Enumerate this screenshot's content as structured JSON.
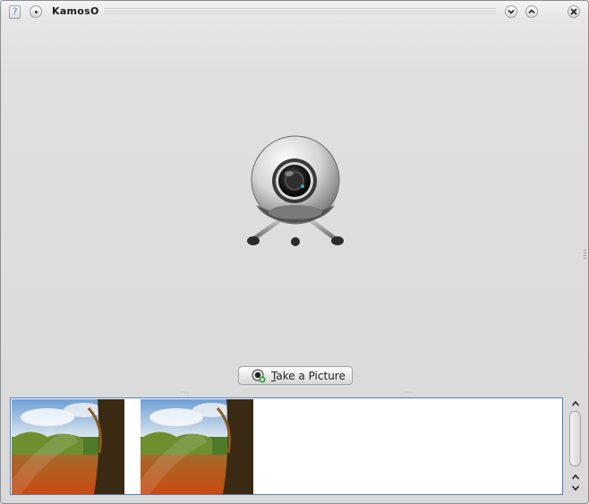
{
  "window": {
    "title": "KamosO"
  },
  "titlebar": {
    "help_glyph": "?",
    "buttons": [
      "help-button",
      "window-menu-button",
      "minimize-button",
      "maximize-button",
      "close-button"
    ]
  },
  "main": {
    "camera_icon": "webcam-icon",
    "take_picture": {
      "label_mnemonic": "T",
      "label_rest": "ake a Picture",
      "icon": "camera-add-icon"
    }
  },
  "gallery": {
    "items": [
      {
        "name": "photo-thumbnail-1",
        "icon": "landscape-photo"
      },
      {
        "name": "photo-thumbnail-2",
        "icon": "landscape-photo"
      }
    ]
  },
  "colors": {
    "accent": "#4f7ec2",
    "window_bg": "#dedede"
  }
}
